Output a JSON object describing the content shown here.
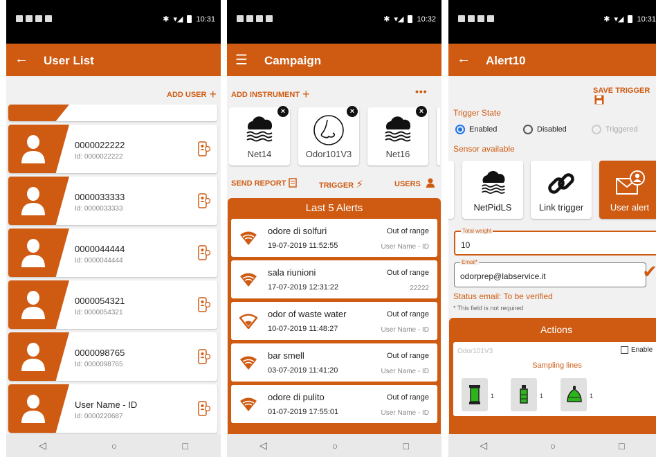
{
  "status": {
    "left_time": "10:31",
    "middle_time": "10:32",
    "right_time": "10:31"
  },
  "user_list_screen": {
    "title": "User List",
    "add_user_label": "ADD USER",
    "users": [
      {
        "name": "0000022222",
        "id": "Id: 0000022222"
      },
      {
        "name": "0000033333",
        "id": "Id: 0000033333"
      },
      {
        "name": "0000044444",
        "id": "Id: 0000044444"
      },
      {
        "name": "0000054321",
        "id": "Id: 0000054321"
      },
      {
        "name": "0000098765",
        "id": "Id: 0000098765"
      },
      {
        "name": "User Name - ID",
        "id": "Id: 0000220687"
      }
    ]
  },
  "campaign_screen": {
    "title": "Campaign",
    "add_instrument_label": "ADD INSTRUMENT",
    "more_label": "•••",
    "instruments": [
      {
        "name": "Net14",
        "icon": "cloud-water-icon"
      },
      {
        "name": "Odor101V3",
        "icon": "nose-icon"
      },
      {
        "name": "Net16",
        "icon": "cloud-water-icon"
      }
    ],
    "send_report_label": "SEND REPORT",
    "trigger_label": "TRIGGER",
    "users_label": "USERS",
    "alerts_title": "Last 5 Alerts",
    "alerts": [
      {
        "name": "odore di solfuri",
        "date": "19-07-2019 11:52:55",
        "status": "Out of range",
        "user": "User Name - ID",
        "filled": true
      },
      {
        "name": "sala riunioni",
        "date": "17-07-2019 12:31:22",
        "status": "Out of range",
        "user": "22222",
        "filled": true
      },
      {
        "name": "odor of waste water",
        "date": "10-07-2019 11:48:27",
        "status": "Out of range",
        "user": "User Name - ID",
        "filled": false
      },
      {
        "name": "bar smell",
        "date": "03-07-2019 11:41:20",
        "status": "Out of range",
        "user": "User Name - ID",
        "filled": true
      },
      {
        "name": "odore di pulito",
        "date": "01-07-2019 17:55:01",
        "status": "Out of range",
        "user": "User Name - ID",
        "filled": true
      }
    ]
  },
  "alert_screen": {
    "title": "Alert10",
    "save_trigger_label": "SAVE TRIGGER",
    "trigger_state_label": "Trigger State",
    "radio_enabled": "Enabled",
    "radio_disabled": "Disabled",
    "radio_triggered": "Triggered",
    "sensor_available_label": "Sensor available",
    "sensors": [
      {
        "name": "NetPidLS",
        "icon": "cloud-water-icon"
      },
      {
        "name": "Link trigger",
        "icon": "link-icon"
      },
      {
        "name": "User alert",
        "icon": "mail-user-icon"
      }
    ],
    "total_weight_label": "Total weight",
    "total_weight_value": "10",
    "email_label": "Email*",
    "email_value": "odorprep@labservice.it",
    "status_email": "Status email:  To be verified",
    "field_note": "* This field is not required",
    "actions_title": "Actions",
    "action_instrument": "Odor101V3",
    "enable_label": "Enable",
    "sampling_lines_label": "Sampling lines",
    "sampling_lines": [
      {
        "count": "1",
        "icon": "tube-green-icon"
      },
      {
        "count": "1",
        "icon": "bottle-green-icon"
      },
      {
        "count": "1",
        "icon": "flask-green-icon"
      }
    ]
  },
  "colors": {
    "accent": "#cf5a11",
    "check_blue": "#1a73e8",
    "line_green": "#2bb51a"
  }
}
